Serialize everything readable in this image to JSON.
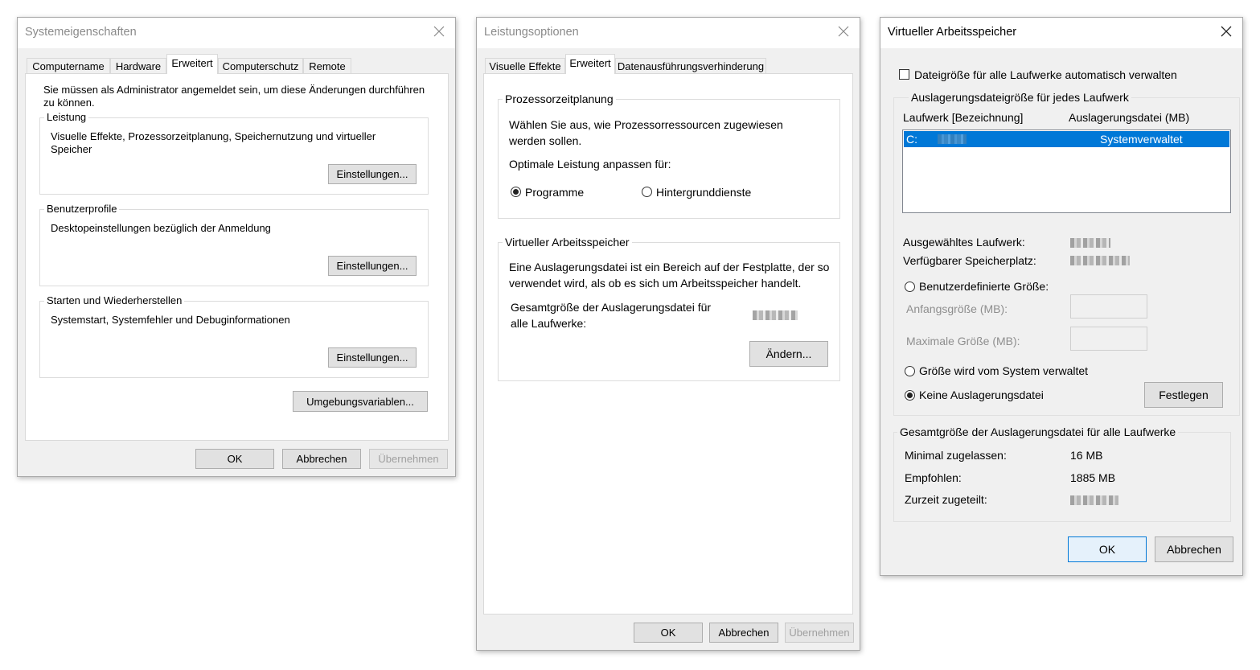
{
  "sys": {
    "title": "Systemeigenschaften",
    "tabs": [
      "Computername",
      "Hardware",
      "Erweitert",
      "Computerschutz",
      "Remote"
    ],
    "admin_note": "Sie müssen als Administrator angemeldet sein, um diese Änderungen durchführen zu können.",
    "groups": [
      {
        "label": "Leistung",
        "desc": "Visuelle Effekte, Prozessorzeitplanung, Speichernutzung und virtueller Speicher",
        "button": "Einstellungen..."
      },
      {
        "label": "Benutzerprofile",
        "desc": "Desktopeinstellungen bezüglich der Anmeldung",
        "button": "Einstellungen..."
      },
      {
        "label": "Starten und Wiederherstellen",
        "desc": "Systemstart, Systemfehler und Debuginformationen",
        "button": "Einstellungen..."
      }
    ],
    "env_button": "Umgebungsvariablen...",
    "ok": "OK",
    "cancel": "Abbrechen",
    "apply": "Übernehmen"
  },
  "perf": {
    "title": "Leistungsoptionen",
    "tabs": [
      "Visuelle Effekte",
      "Erweitert",
      "Datenausführungsverhinderung"
    ],
    "cpu": {
      "label": "Prozessorzeitplanung",
      "desc": "Wählen Sie aus, wie Prozessorressourcen zugewiesen werden sollen.",
      "optimize": "Optimale Leistung anpassen für:",
      "opt_programs": "Programme",
      "opt_services": "Hintergrunddienste"
    },
    "vm": {
      "label": "Virtueller Arbeitsspeicher",
      "desc": "Eine Auslagerungsdatei ist ein Bereich auf der Festplatte, der so verwendet wird, als ob es sich um Arbeitsspeicher handelt.",
      "total": "Gesamtgröße der Auslagerungsdatei für alle Laufwerke:",
      "change": "Ändern..."
    },
    "ok": "OK",
    "cancel": "Abbrechen",
    "apply": "Übernehmen"
  },
  "vmem": {
    "title": "Virtueller Arbeitsspeicher",
    "auto_manage": "Dateigröße für alle Laufwerke automatisch verwalten",
    "per_drive": "Auslagerungsdateigröße für jedes Laufwerk",
    "col_drive": "Laufwerk [Bezeichnung]",
    "col_file": "Auslagerungsdatei (MB)",
    "row_drive": "C:",
    "row_value": "Systemverwaltet",
    "selected_drive": "Ausgewähltes Laufwerk:",
    "free_space": "Verfügbarer Speicherplatz:",
    "custom_size": "Benutzerdefinierte Größe:",
    "initial_size": "Anfangsgröße (MB):",
    "max_size": "Maximale Größe (MB):",
    "system_managed": "Größe wird vom System verwaltet",
    "no_pagefile": "Keine Auslagerungsdatei",
    "set": "Festlegen",
    "total_label": "Gesamtgröße der Auslagerungsdatei für alle Laufwerke",
    "min_allowed": "Minimal zugelassen:",
    "min_allowed_value": "16 MB",
    "recommended": "Empfohlen:",
    "recommended_value": "1885 MB",
    "allocated": "Zurzeit zugeteilt:",
    "ok": "OK",
    "cancel": "Abbrechen"
  }
}
